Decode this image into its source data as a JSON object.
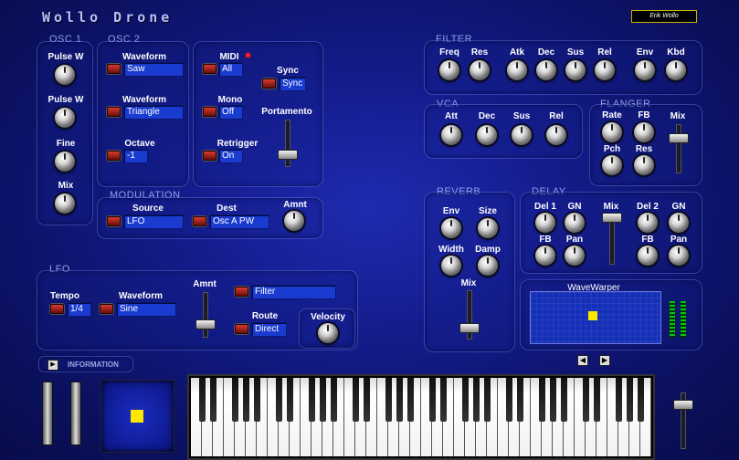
{
  "app": {
    "title": "Wollo Drone",
    "author": "Erik Wollo"
  },
  "osc1": {
    "title": "OSC 1",
    "pulse_w1": "Pulse W",
    "pulse_w2": "Pulse W",
    "fine": "Fine",
    "mix": "Mix"
  },
  "osc2": {
    "title": "OSC 2",
    "waveform1_label": "Waveform",
    "waveform1_value": "Saw",
    "waveform2_label": "Waveform",
    "waveform2_value": "Triangle",
    "octave_label": "Octave",
    "octave_value": "-1"
  },
  "midi": {
    "midi_label": "MIDI",
    "midi_value": "All",
    "sync_label": "Sync",
    "sync_value": "Sync",
    "mono_label": "Mono",
    "mono_value": "Off",
    "portamento_label": "Portamento",
    "retrigger_label": "Retrigger",
    "retrigger_value": "On"
  },
  "modulation": {
    "title": "MODULATION",
    "source_label": "Source",
    "source_value": "LFO",
    "dest_label": "Dest",
    "dest_value": "Osc A PW",
    "amnt_label": "Amnt"
  },
  "lfo": {
    "title": "LFO",
    "tempo_label": "Tempo",
    "tempo_value": "1/4",
    "waveform_label": "Waveform",
    "waveform_value": "Sine",
    "amnt_label": "Amnt",
    "filter_value": "Filter",
    "route_label": "Route",
    "route_value": "Direct",
    "velocity_label": "Velocity"
  },
  "filter": {
    "title": "FILTER",
    "knobs": [
      "Freq",
      "Res",
      "Atk",
      "Dec",
      "Sus",
      "Rel",
      "Env",
      "Kbd"
    ]
  },
  "vca": {
    "title": "VCA",
    "knobs": [
      "Att",
      "Dec",
      "Sus",
      "Rel"
    ]
  },
  "flanger": {
    "title": "FLANGER",
    "rate": "Rate",
    "fb": "FB",
    "mix": "Mix",
    "pch": "Pch",
    "res": "Res"
  },
  "reverb": {
    "title": "REVERB",
    "env": "Env",
    "size": "Size",
    "width": "Width",
    "damp": "Damp",
    "mix": "Mix"
  },
  "delay": {
    "title": "DELAY",
    "del1": "Del 1",
    "gn1": "GN",
    "mix": "Mix",
    "del2": "Del 2",
    "gn2": "GN",
    "fb1": "FB",
    "pan1": "Pan",
    "fb2": "FB",
    "pan2": "Pan"
  },
  "wavewarper": {
    "title": "WaveWarper"
  },
  "info": {
    "label": "INFORMATION"
  },
  "colors": {
    "accent": "#ffe600",
    "button_red": "#d83a30",
    "panel_title": "#8fa0e6"
  },
  "nav": {
    "prev_icon": "chevron-left-icon",
    "next_icon": "chevron-right-icon"
  }
}
